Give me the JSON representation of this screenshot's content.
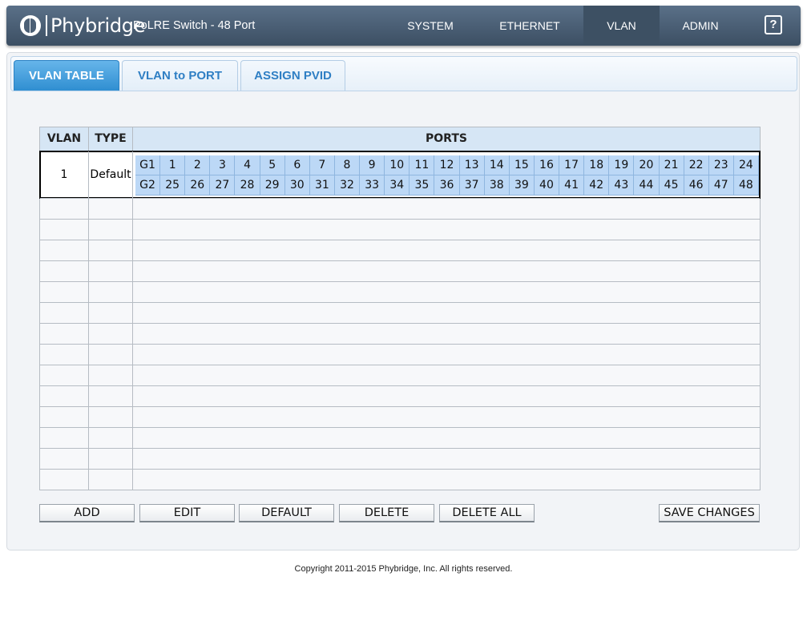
{
  "header": {
    "logo_text": "Phybridge",
    "product": "PoLRE Switch - 48 Port",
    "nav": [
      "SYSTEM",
      "ETHERNET",
      "VLAN",
      "ADMIN"
    ],
    "active_nav": "VLAN",
    "help_label": "?"
  },
  "tabs": {
    "items": [
      "VLAN TABLE",
      "VLAN to PORT",
      "ASSIGN PVID"
    ],
    "active": "VLAN TABLE"
  },
  "table": {
    "headers": {
      "vlan": "VLAN",
      "type": "TYPE",
      "ports": "PORTS"
    },
    "rows": [
      {
        "vlan": "1",
        "type": "Default",
        "ports_row1": [
          "G1",
          "1",
          "2",
          "3",
          "4",
          "5",
          "6",
          "7",
          "8",
          "9",
          "10",
          "11",
          "12",
          "13",
          "14",
          "15",
          "16",
          "17",
          "18",
          "19",
          "20",
          "21",
          "22",
          "23",
          "24"
        ],
        "ports_row2": [
          "G2",
          "25",
          "26",
          "27",
          "28",
          "29",
          "30",
          "31",
          "32",
          "33",
          "34",
          "35",
          "36",
          "37",
          "38",
          "39",
          "40",
          "41",
          "42",
          "43",
          "44",
          "45",
          "46",
          "47",
          "48"
        ]
      }
    ],
    "empty_rows": 14
  },
  "buttons": {
    "add": "ADD",
    "edit": "EDIT",
    "default": "DEFAULT",
    "delete": "DELETE",
    "delete_all": "DELETE ALL",
    "save": "SAVE CHANGES"
  },
  "footer": "Copyright 2011-2015 Phybridge, Inc. All rights reserved.",
  "colors": {
    "header_bg": "#4b6077",
    "tab_active": "#3d9ad9",
    "port_cell": "#bcd8f6"
  }
}
